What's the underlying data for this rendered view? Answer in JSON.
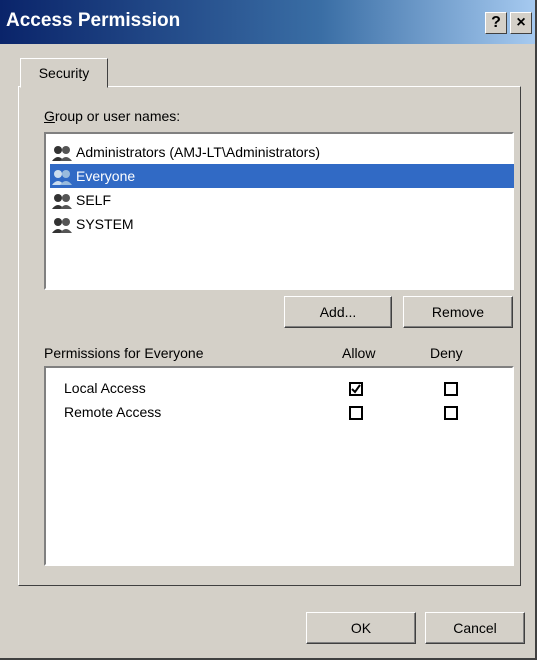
{
  "window": {
    "title": "Access Permission",
    "help_button": "?",
    "close_button": "×"
  },
  "tabs": [
    {
      "label": "Security"
    }
  ],
  "groups": {
    "label": "Group or user names:",
    "items": [
      {
        "label": "Administrators (AMJ-LT\\Administrators)",
        "selected": false
      },
      {
        "label": "Everyone",
        "selected": true
      },
      {
        "label": "SELF",
        "selected": false
      },
      {
        "label": "SYSTEM",
        "selected": false
      }
    ]
  },
  "buttons": {
    "add": "Add...",
    "remove": "Remove",
    "ok": "OK",
    "cancel": "Cancel"
  },
  "permissions": {
    "label": "Permissions for Everyone",
    "allow_header": "Allow",
    "deny_header": "Deny",
    "rows": [
      {
        "label": "Local Access",
        "allow": true,
        "deny": false
      },
      {
        "label": "Remote Access",
        "allow": false,
        "deny": false
      }
    ]
  },
  "icons": {
    "user_group": "user-group-icon",
    "checkmark": "checkmark-icon"
  }
}
